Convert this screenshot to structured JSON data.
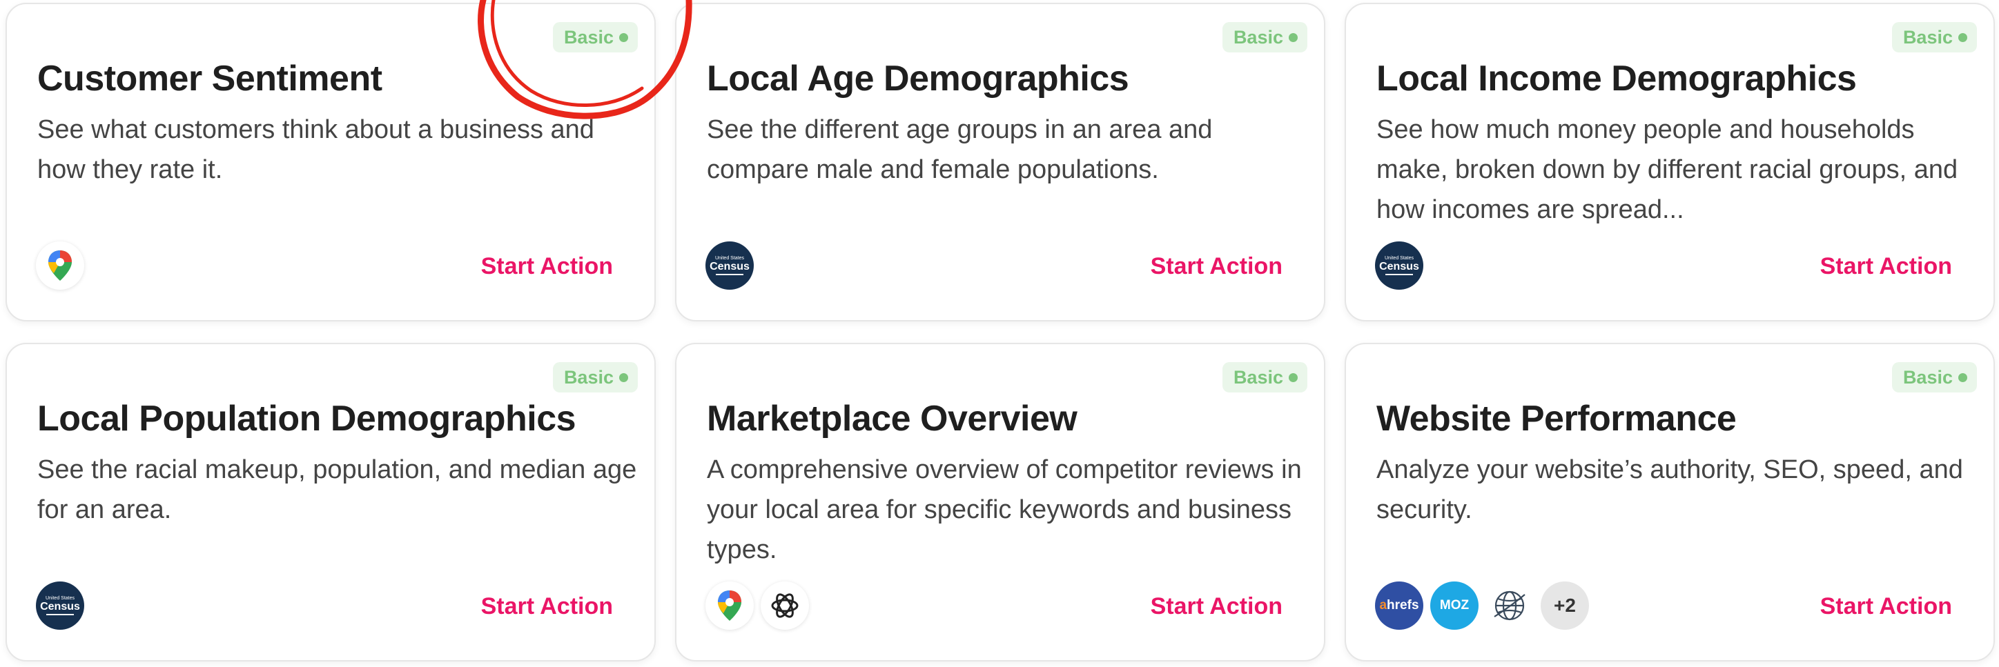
{
  "cards": [
    {
      "badge": "Basic",
      "title": "Customer Sentiment",
      "description": "See what customers think about a business and how they rate it.",
      "icons": [
        "google-maps-icon"
      ],
      "action": "Start Action"
    },
    {
      "badge": "Basic",
      "title": "Local Age Demographics",
      "description": "See the different age groups in an area and compare male and female populations.",
      "icons": [
        "census-icon"
      ],
      "action": "Start Action"
    },
    {
      "badge": "Basic",
      "title": "Local Income Demographics",
      "description": "See how much money people and households make, broken down by different racial groups, and how incomes are spread...",
      "icons": [
        "census-icon"
      ],
      "action": "Start Action"
    },
    {
      "badge": "Basic",
      "title": "Local Population Demographics",
      "description": "See the racial makeup, population, and median age for an area.",
      "icons": [
        "census-icon"
      ],
      "action": "Start Action"
    },
    {
      "badge": "Basic",
      "title": "Marketplace Overview",
      "description": "A comprehensive overview of competitor reviews in your local area for specific keywords and business types.",
      "icons": [
        "google-maps-icon",
        "openai-icon"
      ],
      "action": "Start Action"
    },
    {
      "badge": "Basic",
      "title": "Website Performance",
      "description": "Analyze your website’s authority, SEO, speed, and security.",
      "icons": [
        "ahrefs-icon",
        "moz-icon",
        "globe-icon"
      ],
      "more_count": "+2",
      "action": "Start Action"
    }
  ],
  "icon_text": {
    "census_top": "United States",
    "census_main": "Census",
    "ahrefs_a": "a",
    "ahrefs_rest": "hrefs",
    "moz": "MOZ"
  },
  "colors": {
    "accent": "#ea1566",
    "badge_text": "#7cc57c",
    "badge_bg": "#eaf6ea",
    "annotation": "#e8261a"
  }
}
